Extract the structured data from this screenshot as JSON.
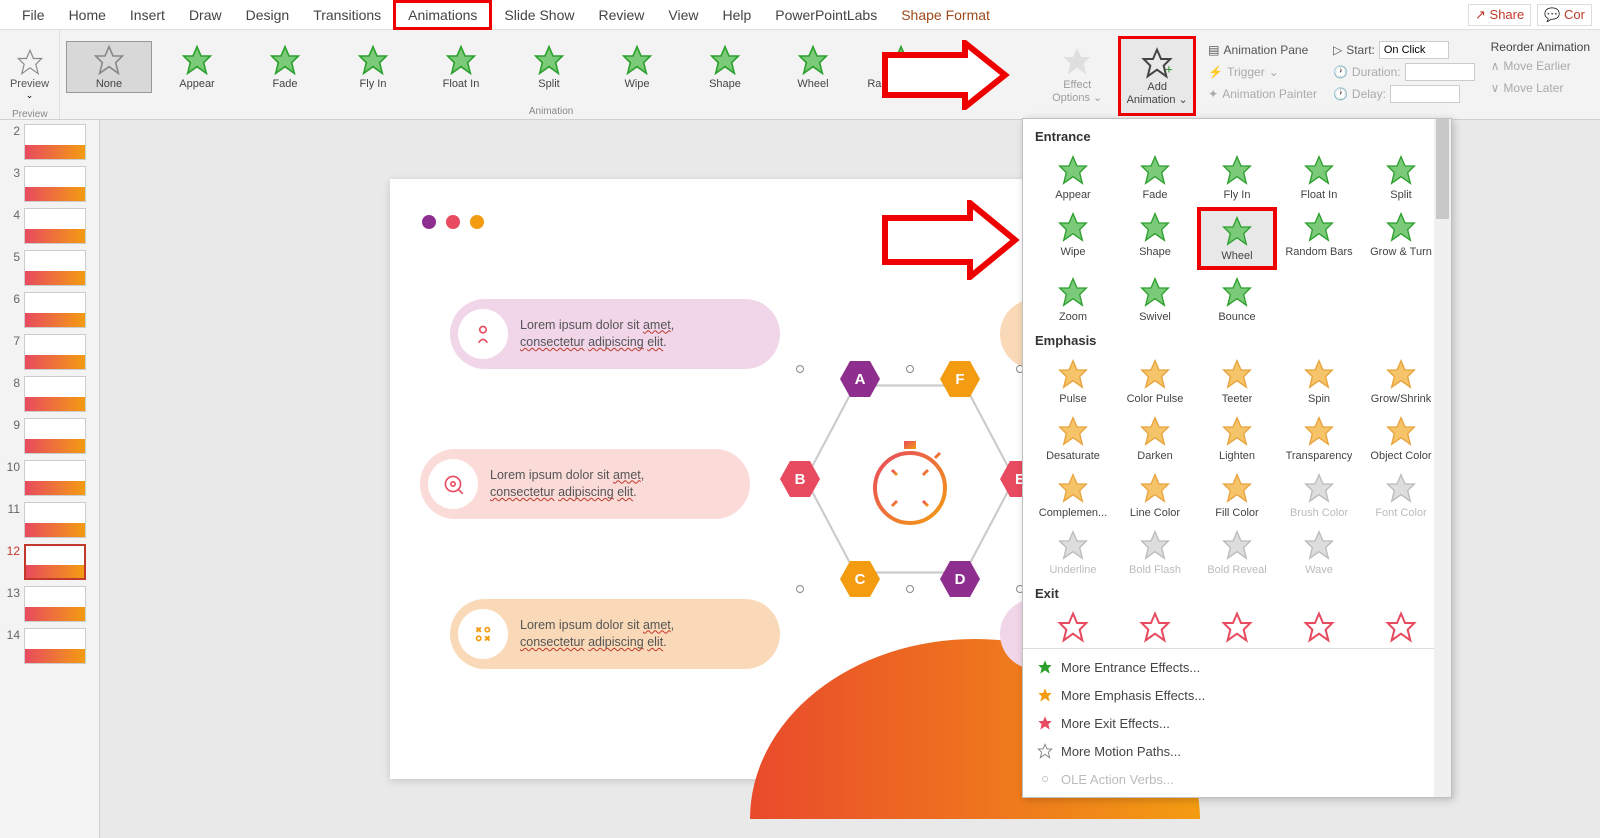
{
  "menubar": {
    "items": [
      "File",
      "Home",
      "Insert",
      "Draw",
      "Design",
      "Transitions",
      "Animations",
      "Slide Show",
      "Review",
      "View",
      "Help",
      "PowerPointLabs",
      "Shape Format"
    ],
    "active_index": 12,
    "highlighted_index": 6,
    "share": "Share",
    "comments": "Cor"
  },
  "ribbon": {
    "preview": {
      "label": "Preview",
      "caption": "Preview"
    },
    "gallery": [
      "None",
      "Appear",
      "Fade",
      "Fly In",
      "Float In",
      "Split",
      "Wipe",
      "Shape",
      "Wheel",
      "Random Bars"
    ],
    "gallery_caption": "Animation",
    "effect_options": "Effect Options",
    "add_animation": "Add Animation",
    "advanced": {
      "pane": "Animation Pane",
      "trigger": "Trigger",
      "painter": "Animation Painter"
    },
    "timing": {
      "start_label": "Start:",
      "start_value": "On Click",
      "duration_label": "Duration:",
      "duration_value": "",
      "delay_label": "Delay:",
      "delay_value": ""
    },
    "reorder": {
      "heading": "Reorder Animation",
      "earlier": "Move Earlier",
      "later": "Move Later"
    }
  },
  "thumbnails": {
    "active": 12,
    "items": [
      2,
      3,
      4,
      5,
      6,
      7,
      8,
      9,
      10,
      11,
      12,
      13,
      14
    ]
  },
  "slide": {
    "pill_text": "Lorem ipsum dolor sit amet, consectetur adipiscing elit.",
    "hex_letters": [
      "A",
      "F",
      "B",
      "E",
      "C",
      "D"
    ],
    "dot_colors": [
      "#8E2E8E",
      "#E84A5F",
      "#F39C12"
    ]
  },
  "dropdown": {
    "sections": {
      "entrance": {
        "heading": "Entrance",
        "items": [
          "Appear",
          "Fade",
          "Fly In",
          "Float In",
          "Split",
          "Wipe",
          "Shape",
          "Wheel",
          "Random Bars",
          "Grow & Turn",
          "Zoom",
          "Swivel",
          "Bounce"
        ],
        "highlighted_index": 7
      },
      "emphasis": {
        "heading": "Emphasis",
        "items": [
          "Pulse",
          "Color Pulse",
          "Teeter",
          "Spin",
          "Grow/Shrink",
          "Desaturate",
          "Darken",
          "Lighten",
          "Transparency",
          "Object Color",
          "Complemen...",
          "Line Color",
          "Fill Color",
          "Brush Color",
          "Font Color",
          "Underline",
          "Bold Flash",
          "Bold Reveal",
          "Wave"
        ],
        "disabled_from": 13
      },
      "exit": {
        "heading": "Exit"
      }
    },
    "footer": {
      "more_entrance": "More Entrance Effects...",
      "more_emphasis": "More Emphasis Effects...",
      "more_exit": "More Exit Effects...",
      "more_motion": "More Motion Paths...",
      "ole": "OLE Action Verbs..."
    }
  }
}
